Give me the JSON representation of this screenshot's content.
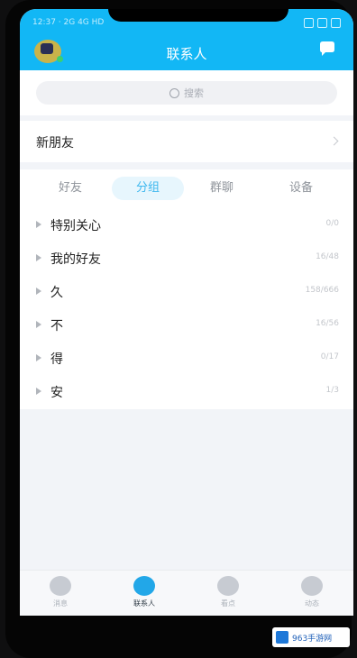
{
  "status": {
    "time": "12:37 · 2G 4G HD"
  },
  "header": {
    "title": "联系人",
    "avatar_icon": "avatar",
    "chat_icon": "message-bubble-icon",
    "accent": "#12b7f5"
  },
  "search": {
    "placeholder": "搜索"
  },
  "new_friends": {
    "label": "新朋友"
  },
  "tabs": [
    {
      "label": "好友",
      "active": false
    },
    {
      "label": "分组",
      "active": true
    },
    {
      "label": "群聊",
      "active": false
    },
    {
      "label": "设备",
      "active": false
    }
  ],
  "groups": [
    {
      "name": "特别关心",
      "count": "0/0"
    },
    {
      "name": "我的好友",
      "count": "16/48"
    },
    {
      "name": "久",
      "count": "158/666"
    },
    {
      "name": "不",
      "count": "16/56"
    },
    {
      "name": "得",
      "count": "0/17"
    },
    {
      "name": "安",
      "count": "1/3"
    }
  ],
  "bottom_nav": [
    {
      "label": "消息",
      "icon": "message-icon",
      "active": false
    },
    {
      "label": "联系人",
      "icon": "contacts-icon",
      "active": true
    },
    {
      "label": "看点",
      "icon": "eye-icon",
      "active": false
    },
    {
      "label": "动态",
      "icon": "planet-icon",
      "active": false
    }
  ],
  "watermark": {
    "text": "963手游网"
  }
}
